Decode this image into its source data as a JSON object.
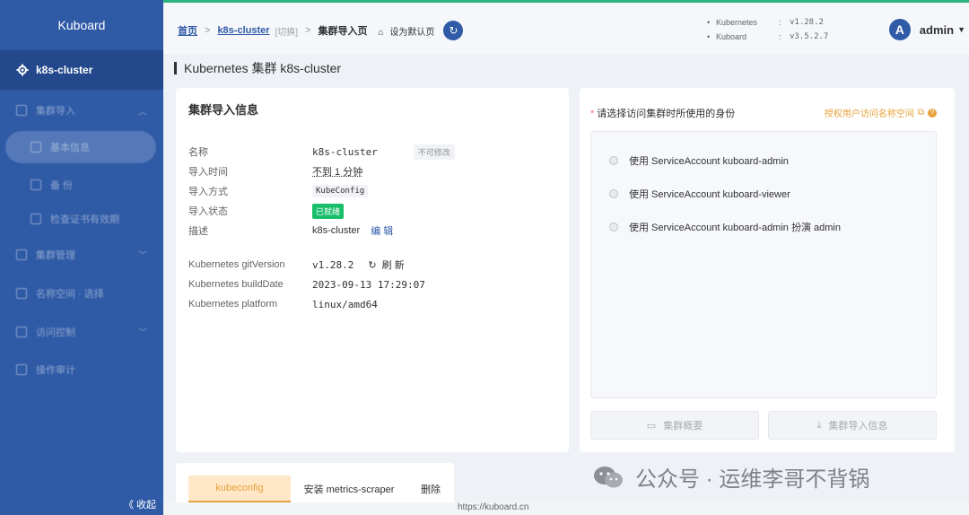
{
  "sidebar": {
    "title": "Kuboard",
    "cluster": "k8s-cluster",
    "items": [
      {
        "label": "集群导入"
      },
      {
        "label": "基本信息"
      },
      {
        "label": "备 份"
      },
      {
        "label": "检查证书有效期"
      },
      {
        "label": "集群管理"
      },
      {
        "label": "名称空间 · 选择"
      },
      {
        "label": "访问控制"
      },
      {
        "label": "操作审计"
      }
    ],
    "collapse_label": "《 收起"
  },
  "header": {
    "breadcrumb": {
      "home": "首页",
      "cluster": "k8s-cluster",
      "switch": "[切换]",
      "current": "集群导入页",
      "set_default": "设为默认页"
    },
    "versions": [
      {
        "name": "Kubernetes",
        "value": "v1.28.2"
      },
      {
        "name": "Kuboard",
        "value": "v3.5.2.7"
      }
    ],
    "user": {
      "avatar_letter": "A",
      "name": "admin"
    }
  },
  "page_title": "Kubernetes 集群 k8s-cluster",
  "info_card": {
    "title": "集群导入信息",
    "rows": [
      {
        "label": "名称",
        "value": "k8s-cluster",
        "tag": "不可修改"
      },
      {
        "label": "导入时间",
        "value": "不到 1 分钟"
      },
      {
        "label": "导入方式",
        "value": "KubeConfig"
      },
      {
        "label": "导入状态",
        "value": "已就绪"
      },
      {
        "label": "描述",
        "value": "k8s-cluster",
        "action": "编 辑"
      }
    ],
    "k8s_rows": [
      {
        "label": "Kubernetes gitVersion",
        "value": "v1.28.2",
        "action": "刷 新"
      },
      {
        "label": "Kubernetes buildDate",
        "value": "2023-09-13 17:29:07"
      },
      {
        "label": "Kubernetes platform",
        "value": "linux/amd64"
      }
    ]
  },
  "identity_card": {
    "prompt": "请选择访问集群时所使用的身份",
    "auth_link": "授权用户访问名称空间",
    "options": [
      "使用 ServiceAccount kuboard-admin",
      "使用 ServiceAccount kuboard-viewer",
      "使用 ServiceAccount kuboard-admin 扮演 admin"
    ],
    "buttons": [
      "集群概要",
      "集群导入信息"
    ]
  },
  "tabs": [
    "kubeconfig",
    "安装 metrics-scraper",
    "删除"
  ],
  "status_url": "https://kuboard.cn",
  "watermark": "公众号 · 运维李哥不背锅",
  "colors": {
    "sidebar": "#2f5aa6",
    "accent": "#e6a23c",
    "success": "#19be6b"
  }
}
